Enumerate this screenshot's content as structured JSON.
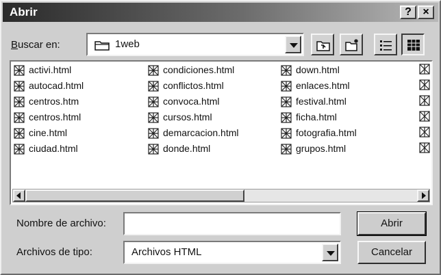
{
  "window": {
    "title": "Abrir"
  },
  "titlebar": {
    "help": "?",
    "close": "×"
  },
  "look_in": {
    "label": "Buscar en:",
    "folder": "1web"
  },
  "files": [
    "activi.html",
    "autocad.html",
    "centros.htm",
    "centros.html",
    "cine.html",
    "ciudad.html",
    "condiciones.html",
    "conflictos.html",
    "convoca.html",
    "cursos.html",
    "demarcacion.html",
    "donde.html",
    "down.html",
    "enlaces.html",
    "festival.html",
    "ficha.html",
    "fotografia.html",
    "grupos.html"
  ],
  "filename": {
    "label": "Nombre de archivo:",
    "value": ""
  },
  "filetype": {
    "label": "Archivos de tipo:",
    "value": "Archivos HTML"
  },
  "buttons": {
    "open": "Abrir",
    "cancel": "Cancelar"
  },
  "icons": {
    "folder": "folder-icon",
    "up": "up-one-level-icon",
    "new_folder": "new-folder-icon",
    "list": "list-view-icon",
    "details": "details-view-icon",
    "file": "html-file-icon"
  }
}
